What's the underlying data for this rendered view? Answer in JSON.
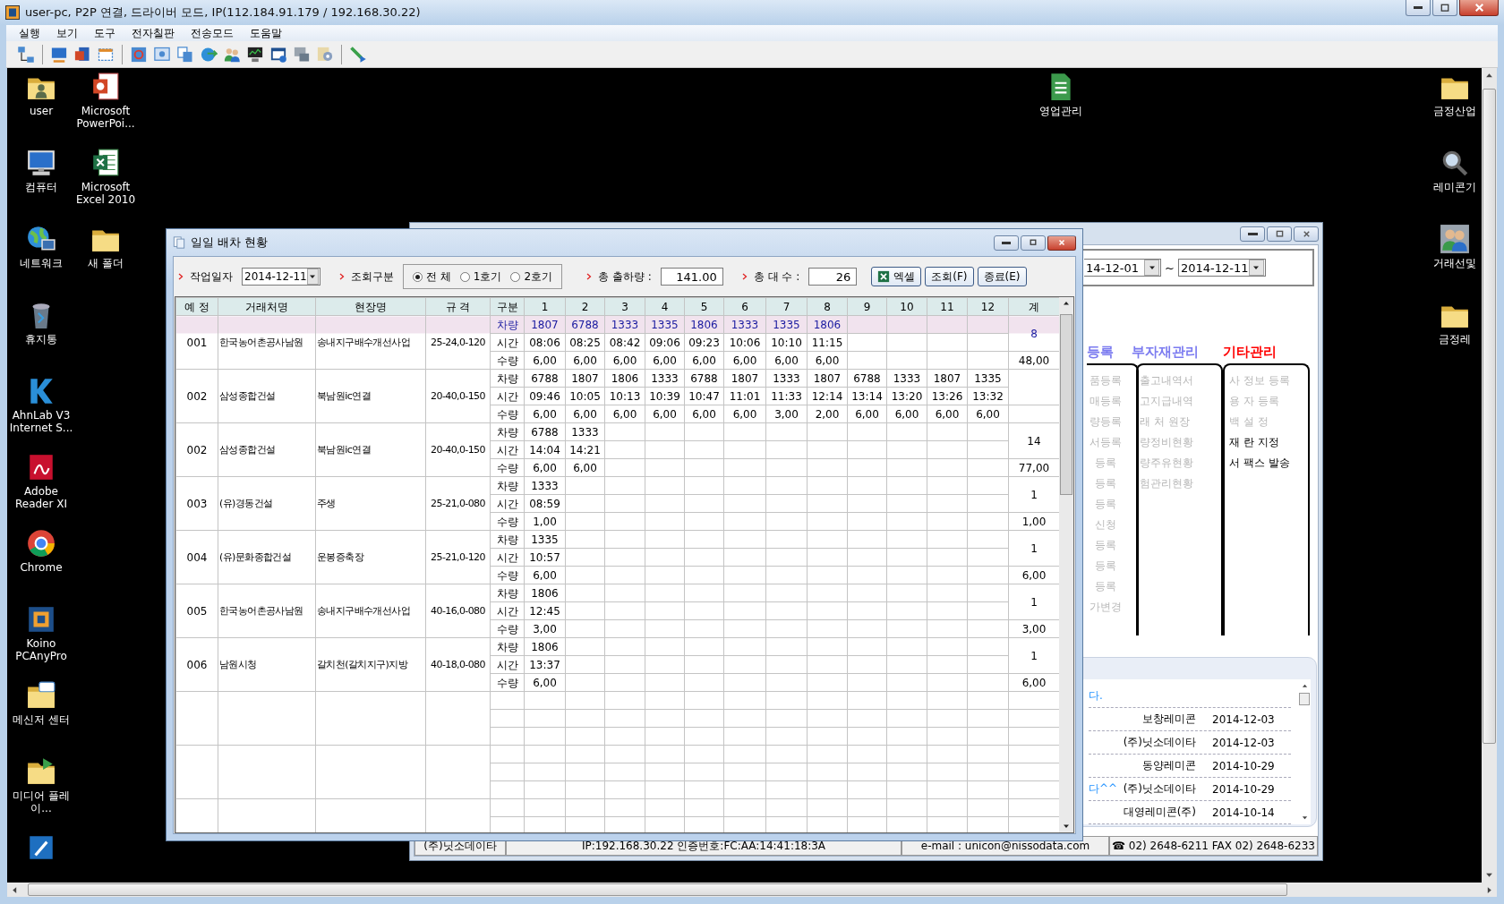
{
  "window": {
    "title": "user-pc, P2P 연결, 드라이버 모드, IP(112.184.91.179 / 192.168.30.22)"
  },
  "menu": [
    "실행",
    "보기",
    "도구",
    "전자칠판",
    "전송모드",
    "도움말"
  ],
  "desktop": {
    "columns": [
      {
        "icons": [
          {
            "label": "user",
            "kind": "user_folder"
          },
          {
            "label": "컴퓨터",
            "kind": "computer"
          },
          {
            "label": "네트워크",
            "kind": "network"
          },
          {
            "label": "휴지통",
            "kind": "trash"
          },
          {
            "label": "AhnLab V3 Internet S...",
            "kind": "antivirus"
          },
          {
            "label": "Adobe Reader XI",
            "kind": "pdf_reader"
          },
          {
            "label": "Chrome",
            "kind": "browser"
          },
          {
            "label": "Koino PCAnyPro",
            "kind": "remote_app"
          },
          {
            "label": "메신저 센터",
            "kind": "messenger"
          },
          {
            "label": "미디어 플레이...",
            "kind": "media"
          },
          {
            "kind": "editor_app"
          }
        ]
      },
      {
        "icons": [
          {
            "label": "Microsoft PowerPoi...",
            "kind": "slides_app"
          },
          {
            "label": "Microsoft Excel 2010",
            "kind": "spreadsheet_app"
          },
          {
            "label": "새 폴더",
            "kind": "folder"
          }
        ]
      },
      {
        "icons": [
          {
            "label": "영업관리",
            "kind": "sales_app"
          }
        ]
      },
      {
        "icons": [
          {
            "label": "금정산업",
            "kind": "folder"
          },
          {
            "label": "레미콘기",
            "kind": "search_app"
          },
          {
            "label": "거래선및",
            "kind": "people"
          },
          {
            "label": "금정레",
            "kind": "folder"
          }
        ]
      }
    ]
  },
  "background_window": {
    "date_from": "14-12-01",
    "date_separator": "~",
    "date_to": "2014-12-11",
    "menu_groups": [
      {
        "heading": "등록",
        "color": "#7b7bf0",
        "items": [
          {
            "label": "품등록",
            "disabled": true
          },
          {
            "label": "매등록",
            "disabled": true
          },
          {
            "label": "량등록",
            "disabled": true
          },
          {
            "label": "서등록",
            "disabled": true
          },
          {
            "label": "등록",
            "disabled": true
          },
          {
            "label": "등록",
            "disabled": true
          },
          {
            "label": "등록",
            "disabled": true
          },
          {
            "label": "신청",
            "disabled": true
          },
          {
            "label": "등록",
            "disabled": true
          },
          {
            "label": "등록",
            "disabled": true
          },
          {
            "label": "등록",
            "disabled": true
          },
          {
            "label": "가변경",
            "disabled": true
          }
        ]
      },
      {
        "heading": "부자재관리",
        "color": "#7b7bf0",
        "items": [
          {
            "label": "출고내역서",
            "disabled": true
          },
          {
            "label": "고지급내역",
            "disabled": true
          },
          {
            "label": "래 처 원장",
            "disabled": true
          },
          {
            "label": "량정비현황",
            "disabled": true
          },
          {
            "label": "량주유현황",
            "disabled": true
          },
          {
            "label": "험관리현황",
            "disabled": true
          }
        ]
      },
      {
        "heading": "기타관리",
        "color": "#ff0000",
        "items": [
          {
            "label": "사 정보 등록",
            "disabled": true
          },
          {
            "label": "용 자 등록",
            "disabled": true
          },
          {
            "label": "백 설 정",
            "disabled": true
          },
          {
            "label": "재 란 지정",
            "disabled": false
          },
          {
            "label": "서 팩스 발송",
            "disabled": false
          }
        ]
      }
    ],
    "notices": [
      {
        "message": "다."
      },
      {
        "company": "보창레미콘",
        "date": "2014-12-03"
      },
      {
        "company": "(주)닛소데이타",
        "date": "2014-12-03"
      },
      {
        "company": "동양레미콘",
        "date": "2014-10-29"
      },
      {
        "message": "다^^",
        "company": "(주)닛소데이타",
        "date": "2014-10-29"
      },
      {
        "company": "대영레미콘(주)",
        "date": "2014-10-14"
      }
    ],
    "status_bar": [
      "(주)닛소데이타",
      "IP:192.168.30.22  인증번호:FC:AA:14:41:18:3A",
      "e-mail : unicon@nissodata.com",
      "☎ 02) 2648-6211  FAX  02) 2648-6233"
    ]
  },
  "dialog": {
    "title": "일일 배차 현황",
    "work_date_label": "작업일자",
    "work_date": "2014-12-11",
    "query_type_label": "조회구분",
    "query_options": [
      {
        "label": "전 체",
        "selected": true
      },
      {
        "label": "1호기",
        "selected": false
      },
      {
        "label": "2호기",
        "selected": false
      }
    ],
    "total_output_label": "총 출하량 :",
    "total_output": "141.00",
    "total_trucks_label": "총 대 수 :",
    "total_trucks": "26",
    "buttons": [
      {
        "label": "엑셀",
        "kind": "excel"
      },
      {
        "label": "조회(F)",
        "kind": "plain"
      },
      {
        "label": "종료(E)",
        "kind": "plain"
      }
    ],
    "table": {
      "columns": [
        "예 정",
        "거래처명",
        "현장명",
        "규 격",
        "구분",
        "1",
        "2",
        "3",
        "4",
        "5",
        "6",
        "7",
        "8",
        "9",
        "10",
        "11",
        "12",
        "계"
      ],
      "groups": [
        {
          "no": "001",
          "client": "한국농어촌공사남원",
          "site": "송내지구배수개선사업",
          "spec": "25-24,0-120",
          "selected": true,
          "count": "8",
          "quantity_total": "48,00",
          "rows": [
            {
              "label": "차량",
              "values": [
                "1807",
                "6788",
                "1333",
                "1335",
                "1806",
                "1333",
                "1335",
                "1806"
              ]
            },
            {
              "label": "시간",
              "values": [
                "08:06",
                "08:25",
                "08:42",
                "09:06",
                "09:23",
                "10:06",
                "10:10",
                "11:15"
              ]
            },
            {
              "label": "수량",
              "values": [
                "6,00",
                "6,00",
                "6,00",
                "6,00",
                "6,00",
                "6,00",
                "6,00",
                "6,00"
              ]
            }
          ]
        },
        {
          "no": "002",
          "client": "삼성종합건설",
          "site": "북남원ic연결",
          "spec": "20-40,0-150",
          "selected": false,
          "rows": [
            {
              "label": "차량",
              "values": [
                "6788",
                "1807",
                "1806",
                "1333",
                "6788",
                "1807",
                "1333",
                "1807",
                "6788",
                "1333",
                "1807",
                "1335"
              ]
            },
            {
              "label": "시간",
              "values": [
                "09:46",
                "10:05",
                "10:13",
                "10:39",
                "10:47",
                "11:01",
                "11:33",
                "12:14",
                "13:14",
                "13:20",
                "13:26",
                "13:32"
              ]
            },
            {
              "label": "수량",
              "values": [
                "6,00",
                "6,00",
                "6,00",
                "6,00",
                "6,00",
                "6,00",
                "3,00",
                "2,00",
                "6,00",
                "6,00",
                "6,00",
                "6,00"
              ]
            }
          ]
        },
        {
          "no": "002",
          "client": "삼성종합건설",
          "site": "북남원ic연결",
          "spec": "20-40,0-150",
          "selected": false,
          "count": "14",
          "quantity_total": "77,00",
          "rows": [
            {
              "label": "차량",
              "values": [
                "6788",
                "1333"
              ]
            },
            {
              "label": "시간",
              "values": [
                "14:04",
                "14:21"
              ]
            },
            {
              "label": "수량",
              "values": [
                "6,00",
                "6,00"
              ]
            }
          ]
        },
        {
          "no": "003",
          "client": "(유)경동건설",
          "site": "주생",
          "spec": "25-21,0-080",
          "selected": false,
          "count": "1",
          "quantity_total": "1,00",
          "rows": [
            {
              "label": "차량",
              "values": [
                "1333"
              ]
            },
            {
              "label": "시간",
              "values": [
                "08:59"
              ]
            },
            {
              "label": "수량",
              "values": [
                "1,00"
              ]
            }
          ]
        },
        {
          "no": "004",
          "client": "(유)문화종합건설",
          "site": "운봉증축장",
          "spec": "25-21,0-120",
          "selected": false,
          "count": "1",
          "quantity_total": "6,00",
          "rows": [
            {
              "label": "차량",
              "values": [
                "1335"
              ]
            },
            {
              "label": "시간",
              "values": [
                "10:57"
              ]
            },
            {
              "label": "수량",
              "values": [
                "6,00"
              ]
            }
          ]
        },
        {
          "no": "005",
          "client": "한국농어촌공사남원",
          "site": "송내지구배수개선사업",
          "spec": "40-16,0-080",
          "selected": false,
          "count": "1",
          "quantity_total": "3,00",
          "rows": [
            {
              "label": "차량",
              "values": [
                "1806"
              ]
            },
            {
              "label": "시간",
              "values": [
                "12:45"
              ]
            },
            {
              "label": "수량",
              "values": [
                "3,00"
              ]
            }
          ]
        },
        {
          "no": "006",
          "client": "남원시청",
          "site": "갈치천(갈치지구)지방",
          "spec": "40-18,0-080",
          "selected": false,
          "count": "1",
          "quantity_total": "6,00",
          "rows": [
            {
              "label": "차량",
              "values": [
                "1806"
              ]
            },
            {
              "label": "시간",
              "values": [
                "13:37"
              ]
            },
            {
              "label": "수량",
              "values": [
                "6,00"
              ]
            }
          ]
        }
      ]
    }
  }
}
